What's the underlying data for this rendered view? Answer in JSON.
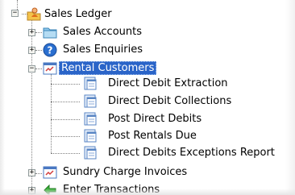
{
  "tree": {
    "root": {
      "label": "Sales Ledger",
      "expander": "−",
      "icon": "user-folder-icon"
    },
    "items": [
      {
        "label": "Sales Accounts",
        "expander": "+",
        "icon": "folder-icon"
      },
      {
        "label": "Sales Enquiries",
        "expander": "+",
        "icon": "help-icon"
      },
      {
        "label": "Rental Customers",
        "expander": "−",
        "icon": "window-icon",
        "selected": true,
        "children": [
          {
            "label": "Direct Debit Extraction",
            "icon": "document-window-icon"
          },
          {
            "label": "Direct Debit Collections",
            "icon": "document-window-icon"
          },
          {
            "label": "Post Direct Debits",
            "icon": "document-window-icon"
          },
          {
            "label": "Post Rentals Due",
            "icon": "document-window-icon"
          },
          {
            "label": "Direct Debits Exceptions Report",
            "icon": "document-window-icon"
          }
        ]
      },
      {
        "label": "Sundry Charge Invoices",
        "expander": "+",
        "icon": "window-icon"
      },
      {
        "label": "Enter Transactions",
        "expander": "+",
        "icon": "green-arrow-icon"
      }
    ]
  },
  "colors": {
    "selection": "#2a64c8",
    "tree_lines": "#808080"
  }
}
